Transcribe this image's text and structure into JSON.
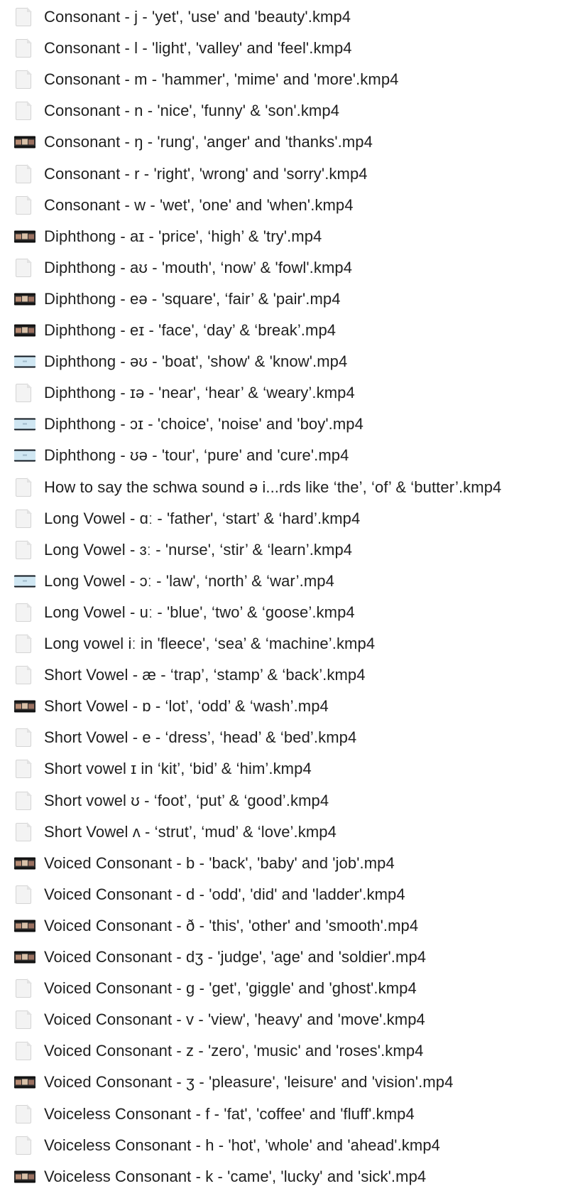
{
  "files": [
    {
      "name": "Consonant - j - 'yet', 'use' and 'beauty'.kmp4",
      "icon": "document-icon"
    },
    {
      "name": "Consonant - l - 'light', 'valley' and 'feel'.kmp4",
      "icon": "document-icon"
    },
    {
      "name": "Consonant - m - 'hammer', 'mime' and 'more'.kmp4",
      "icon": "document-icon"
    },
    {
      "name": "Consonant - n - 'nice', 'funny' & 'son'.kmp4",
      "icon": "document-icon"
    },
    {
      "name": "Consonant - ŋ - 'rung', 'anger' and 'thanks'.mp4",
      "icon": "video-thumbnail-icon"
    },
    {
      "name": "Consonant - r - 'right', 'wrong' and 'sorry'.kmp4",
      "icon": "document-icon"
    },
    {
      "name": "Consonant - w - 'wet', 'one' and 'when'.kmp4",
      "icon": "document-icon"
    },
    {
      "name": "Diphthong - aɪ - 'price', ‘high’ & 'try'.mp4",
      "icon": "video-thumbnail-icon"
    },
    {
      "name": "Diphthong - aʊ - 'mouth', ‘now’ & 'fowl'.kmp4",
      "icon": "document-icon"
    },
    {
      "name": "Diphthong - eə - 'square', ‘fair’ & 'pair'.mp4",
      "icon": "video-thumbnail-icon"
    },
    {
      "name": "Diphthong - eɪ - 'face', ‘day’ & ‘break’.mp4",
      "icon": "video-thumbnail-icon"
    },
    {
      "name": "Diphthong - əʊ - 'boat', 'show' & 'know'.mp4",
      "icon": "video-thumbnail-light-icon"
    },
    {
      "name": "Diphthong - ɪə - 'near', ‘hear’ & ‘weary’.kmp4",
      "icon": "document-icon"
    },
    {
      "name": "Diphthong - ɔɪ - 'choice', 'noise' and 'boy'.mp4",
      "icon": "video-thumbnail-light-icon"
    },
    {
      "name": "Diphthong - ʊə - 'tour', ‘pure' and 'cure'.mp4",
      "icon": "video-thumbnail-light-icon"
    },
    {
      "name": "How to say the schwa sound ə i...rds like ‘the’, ‘of’ & ‘butter’.kmp4",
      "icon": "document-icon"
    },
    {
      "name": "Long Vowel - ɑː - 'father', ‘start’ & ‘hard’.kmp4",
      "icon": "document-icon"
    },
    {
      "name": "Long Vowel - ɜː - 'nurse', ‘stir’ & ‘learn’.kmp4",
      "icon": "document-icon"
    },
    {
      "name": "Long Vowel - ɔː - 'law', ‘north’ & ‘war’.mp4",
      "icon": "video-thumbnail-light-icon"
    },
    {
      "name": "Long Vowel - uː - 'blue', ‘two’ & ‘goose’.kmp4",
      "icon": "document-icon"
    },
    {
      "name": "Long vowel iː in 'fleece', ‘sea’ & ‘machine’.kmp4",
      "icon": "document-icon"
    },
    {
      "name": "Short Vowel - æ - ‘trap’, ‘stamp’ & ‘back’.kmp4",
      "icon": "document-icon"
    },
    {
      "name": "Short Vowel - ɒ - ‘lot’, ‘odd’ & ‘wash’.mp4",
      "icon": "video-thumbnail-icon"
    },
    {
      "name": "Short Vowel - e - ‘dress’, ‘head’ & ‘bed’.kmp4",
      "icon": "document-icon"
    },
    {
      "name": "Short vowel ɪ in ‘kit’, ‘bid’ & ‘him’.kmp4",
      "icon": "document-icon"
    },
    {
      "name": "Short vowel ʊ - ‘foot’, ‘put’ & ‘good’.kmp4",
      "icon": "document-icon"
    },
    {
      "name": "Short Vowel ʌ - ‘strut’, ‘mud’ & ‘love’.kmp4",
      "icon": "document-icon"
    },
    {
      "name": "Voiced Consonant - b - 'back', 'baby' and 'job'.mp4",
      "icon": "video-thumbnail-icon"
    },
    {
      "name": "Voiced Consonant - d - 'odd', 'did' and 'ladder'.kmp4",
      "icon": "document-icon"
    },
    {
      "name": "Voiced Consonant - ð - 'this', 'other' and 'smooth'.mp4",
      "icon": "video-thumbnail-icon"
    },
    {
      "name": "Voiced Consonant - dʒ - 'judge', 'age' and 'soldier'.mp4",
      "icon": "video-thumbnail-icon"
    },
    {
      "name": "Voiced Consonant - g - 'get', 'giggle' and 'ghost'.kmp4",
      "icon": "document-icon"
    },
    {
      "name": "Voiced Consonant - v - 'view', 'heavy' and 'move'.kmp4",
      "icon": "document-icon"
    },
    {
      "name": "Voiced Consonant - z - 'zero', 'music' and 'roses'.kmp4",
      "icon": "document-icon"
    },
    {
      "name": "Voiced Consonant - ʒ - 'pleasure', 'leisure' and 'vision'.mp4",
      "icon": "video-thumbnail-icon"
    },
    {
      "name": "Voiceless Consonant - f - 'fat', 'coffee' and 'fluff'.kmp4",
      "icon": "document-icon"
    },
    {
      "name": "Voiceless Consonant - h - 'hot', 'whole' and 'ahead'.kmp4",
      "icon": "document-icon"
    },
    {
      "name": "Voiceless Consonant - k - 'came', 'lucky' and 'sick'.mp4",
      "icon": "video-thumbnail-icon"
    }
  ]
}
